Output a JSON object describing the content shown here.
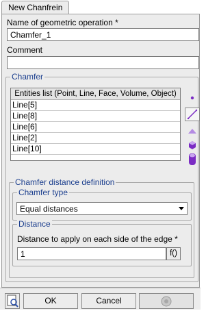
{
  "tab": {
    "title": "New Chanfrein"
  },
  "form": {
    "name_label": "Name of geometric operation *",
    "name_value": "Chamfer_1",
    "comment_label": "Comment",
    "comment_value": ""
  },
  "chamfer": {
    "legend": "Chamfer",
    "list_header": "Entities list (Point, Line, Face, Volume, Object)",
    "entities": [
      "Line[5]",
      "Line[8]",
      "Line[6]",
      "Line[2]",
      "Line[10]"
    ],
    "filter_icons": [
      "point-filter-icon",
      "line-filter-icon",
      "face-filter-icon",
      "volume-filter-icon",
      "object-filter-icon"
    ]
  },
  "definition": {
    "legend": "Chamfer distance definition",
    "type_legend": "Chamfer type",
    "type_value": "Equal distances",
    "distance_legend": "Distance",
    "distance_label": "Distance to apply on each side of the edge *",
    "distance_value": "1",
    "function_button": "f()"
  },
  "buttons": {
    "ok": "OK",
    "cancel": "Cancel"
  },
  "colors": {
    "legend": "#1c3f8e",
    "icon_purple": "#7b2cc4",
    "panel": "#ececec"
  }
}
